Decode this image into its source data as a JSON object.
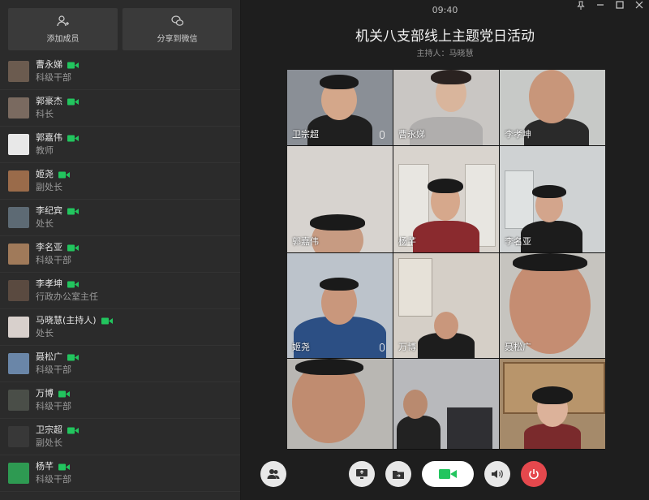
{
  "sidebar": {
    "add_member": "添加成员",
    "share_wechat": "分享到微信",
    "members": [
      {
        "name": "曹永娣",
        "role": "科级干部",
        "color": "#6b5b4f"
      },
      {
        "name": "郭豪杰",
        "role": "科长",
        "color": "#7a6a60"
      },
      {
        "name": "郭嘉伟",
        "role": "教师",
        "color": "#e8e8e8"
      },
      {
        "name": "姬尧",
        "role": "副处长",
        "color": "#9a6b4a"
      },
      {
        "name": "李纪宾",
        "role": "处长",
        "color": "#5d6a74"
      },
      {
        "name": "李名亚",
        "role": "科级干部",
        "color": "#a07a5a"
      },
      {
        "name": "李孝坤",
        "role": "行政办公室主任",
        "color": "#5a4a40"
      },
      {
        "name": "马晓慧(主持人)",
        "role": "处长",
        "color": "#d8d0cc"
      },
      {
        "name": "聂松广",
        "role": "科级干部",
        "color": "#6a86a8"
      },
      {
        "name": "万博",
        "role": "科级干部",
        "color": "#4a4e48"
      },
      {
        "name": "卫宗超",
        "role": "副处长",
        "color": "#383838"
      },
      {
        "name": "杨芊",
        "role": "科级干部",
        "color": "#2e9a52"
      }
    ]
  },
  "main": {
    "time": "09:40",
    "title": "机关八支部线上主题党日活动",
    "host": "主持人：马晓慧"
  },
  "tiles": [
    {
      "name": "卫宗超",
      "bg": "#8a8f96"
    },
    {
      "name": "曹永娣",
      "bg": "#c9c6c3"
    },
    {
      "name": "李孝坤",
      "bg": "#c7c9c7"
    },
    {
      "name": "郭嘉伟",
      "bg": "#d7d3cf"
    },
    {
      "name": "杨芊",
      "bg": "#d9d4ce"
    },
    {
      "name": "李名亚",
      "bg": "#cfd2d3"
    },
    {
      "name": "姬尧",
      "bg": "#bcc3cb"
    },
    {
      "name": "万博",
      "bg": "#d5cfc7"
    },
    {
      "name": "聂松广",
      "bg": "#c6c4bf"
    },
    {
      "name": "",
      "bg": "#b9b7b3"
    },
    {
      "name": "",
      "bg": "#b8b9bc"
    },
    {
      "name": "",
      "bg": "#a58a6a"
    }
  ],
  "icons": {
    "camera_color": "#22c55e",
    "end_call_color": "#e5484d"
  }
}
